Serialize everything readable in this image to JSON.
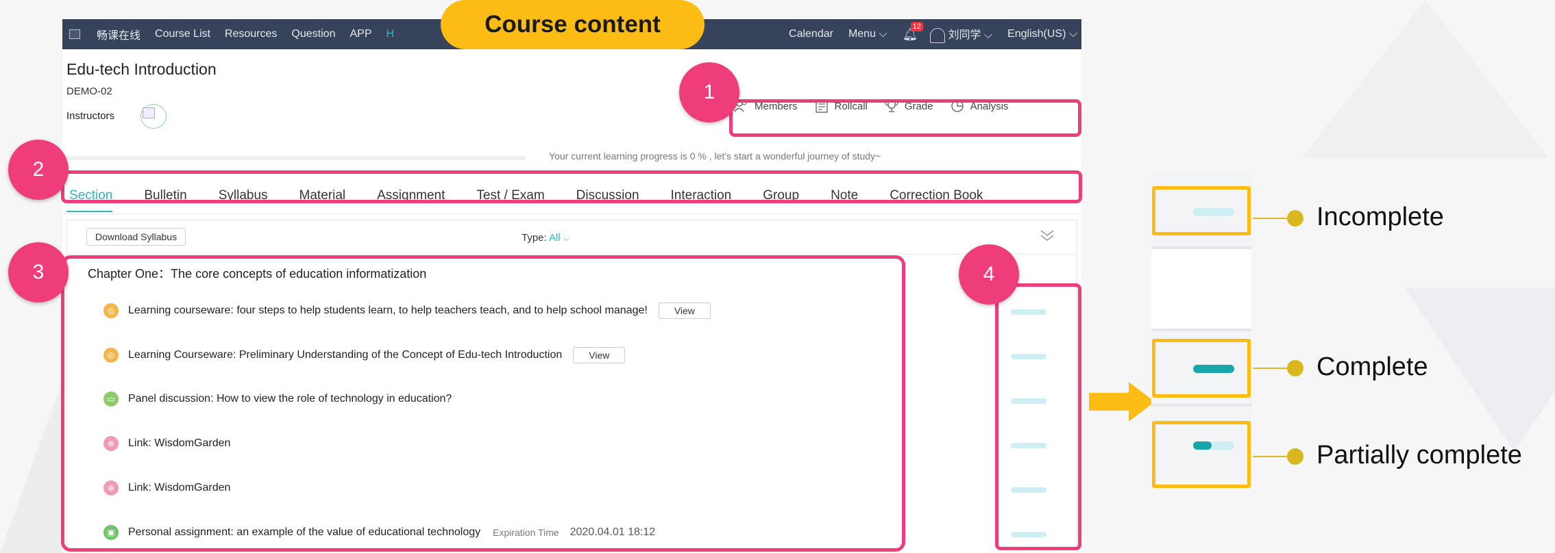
{
  "banner": {
    "label": "Course content"
  },
  "topnav": {
    "items": [
      "畅课在线",
      "Course List",
      "Resources",
      "Question",
      "APP",
      "H"
    ],
    "right": {
      "calendar": "Calendar",
      "menu": "Menu",
      "badge_count": "12",
      "user": "刘同学",
      "language": "English(US)"
    }
  },
  "course": {
    "title": "Edu-tech Introduction",
    "code": "DEMO-02",
    "instructors_label": "Instructors"
  },
  "actions": [
    {
      "label": "Members",
      "icon": "members-icon"
    },
    {
      "label": "Rollcall",
      "icon": "rollcall-icon"
    },
    {
      "label": "Grade",
      "icon": "trophy-icon"
    },
    {
      "label": "Analysis",
      "icon": "pie-chart-icon"
    }
  ],
  "progress": {
    "percent": 0,
    "text": "Your current learning progress is 0 % , let's start a wonderful journey of study~"
  },
  "tabs": [
    "Section",
    "Bulletin",
    "Syllabus",
    "Material",
    "Assignment",
    "Test / Exam",
    "Discussion",
    "Interaction",
    "Group",
    "Note",
    "Correction Book"
  ],
  "toolbar": {
    "download_label": "Download Syllabus",
    "type_label": "Type:",
    "type_value": "All"
  },
  "chapter": {
    "title": "Chapter One：The core concepts of education informatization"
  },
  "activities": [
    {
      "title": "Learning courseware: four steps to help students learn, to help teachers teach, and to help school manage!",
      "view": "View",
      "color": "#f3b64a",
      "icon": "courseware-icon"
    },
    {
      "title": "Learning Courseware: Preliminary Understanding of the Concept of Edu-tech Introduction",
      "view": "View",
      "color": "#f3b64a",
      "icon": "courseware-icon"
    },
    {
      "title": "Panel discussion: How to view the role of technology in education?",
      "color": "#8dcb6a",
      "icon": "discussion-icon"
    },
    {
      "title": "Link: WisdomGarden",
      "color": "#ef9ab8",
      "icon": "link-icon"
    },
    {
      "title": "Link: WisdomGarden",
      "color": "#ef9ab8",
      "icon": "link-icon"
    },
    {
      "title": "Personal assignment: an example of the value of educational technology",
      "expiration_label": "Expiration Time",
      "expiration": "2020.04.01 18:12",
      "color": "#6ec46a",
      "icon": "assignment-icon"
    }
  ],
  "annotations": [
    "1",
    "2",
    "3",
    "4"
  ],
  "legend": [
    {
      "label": "Incomplete",
      "progress": 0
    },
    {
      "label": "Complete",
      "progress": 1
    },
    {
      "label": "Partially complete",
      "progress": 0.45
    }
  ],
  "colors": {
    "nav_bg": "#37435a",
    "accent": "#2eb7c0",
    "highlight": "#ef3d7b",
    "banner": "#fcbc14"
  }
}
